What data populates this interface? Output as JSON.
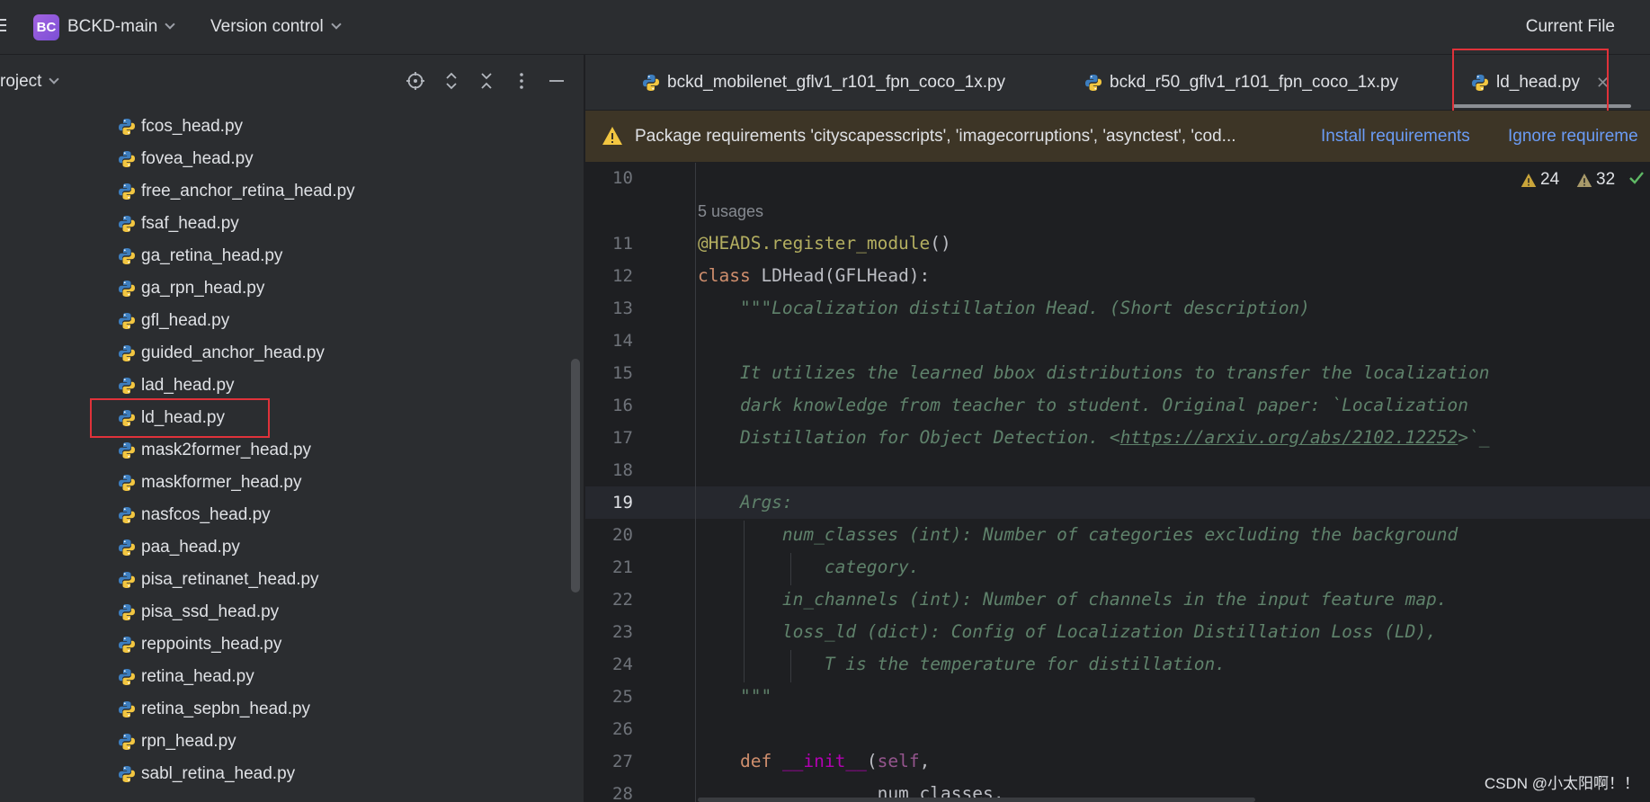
{
  "titlebar": {
    "project_badge": "BC",
    "project_name": "BCKD-main",
    "version_control": "Version control",
    "current_file": "Current File"
  },
  "project_panel": {
    "title": "roject",
    "files": [
      "fcos_head.py",
      "fovea_head.py",
      "free_anchor_retina_head.py",
      "fsaf_head.py",
      "ga_retina_head.py",
      "ga_rpn_head.py",
      "gfl_head.py",
      "guided_anchor_head.py",
      "lad_head.py",
      "ld_head.py",
      "mask2former_head.py",
      "maskformer_head.py",
      "nasfcos_head.py",
      "paa_head.py",
      "pisa_retinanet_head.py",
      "pisa_ssd_head.py",
      "reppoints_head.py",
      "retina_head.py",
      "retina_sepbn_head.py",
      "rpn_head.py",
      "sabl_retina_head.py"
    ]
  },
  "tabs": [
    {
      "label": "bckd_mobilenet_gflv1_r101_fpn_coco_1x.py"
    },
    {
      "label": "bckd_r50_gflv1_r101_fpn_coco_1x.py"
    },
    {
      "label": "ld_head.py"
    }
  ],
  "banner": {
    "text": "Package requirements 'cityscapesscripts', 'imagecorruptions', 'asynctest', 'cod...",
    "install": "Install requirements",
    "ignore": "Ignore requireme"
  },
  "editor": {
    "warnings": "24",
    "weak_warnings": "32",
    "usages": "5 usages",
    "line_numbers": [
      "10",
      "11",
      "12",
      "13",
      "14",
      "15",
      "16",
      "17",
      "18",
      "19",
      "20",
      "21",
      "22",
      "23",
      "24",
      "25",
      "26",
      "27",
      "28"
    ],
    "current_line": "19",
    "lines": {
      "l11_decor": "@HEADS.register_module",
      "l11_paren": "()",
      "l12_kw": "class",
      "l12_rest": " LDHead(GFLHead):",
      "l13": "    \"\"\"Localization distillation Head. (Short description)",
      "l15": "    It utilizes the learned bbox distributions to transfer the localization",
      "l16": "    dark knowledge from teacher to student. Original paper: `Localization",
      "l17_a": "    Distillation for Object Detection. <",
      "l17_link": "https://arxiv.org/abs/2102.12252",
      "l17_b": ">`_",
      "l19": "    Args:",
      "l20": "        num_classes (int): Number of categories excluding the background",
      "l21": "            category.",
      "l22": "        in_channels (int): Number of channels in the input feature map.",
      "l23": "        loss_ld (dict): Config of Localization Distillation Loss (LD),",
      "l24": "            T is the temperature for distillation.",
      "l25": "    \"\"\"",
      "l27_kw": "    def",
      "l27_name": "__init__",
      "l27_p": "(",
      "l27_self": "self",
      "l27_c": ",",
      "l28": "                 num_classes,"
    }
  },
  "watermark": "CSDN @小太阳啊！！",
  "colors": {
    "accent_red_box": "#e0323a",
    "link_blue": "#6b9cf5",
    "banner_bg": "#3d3526"
  }
}
